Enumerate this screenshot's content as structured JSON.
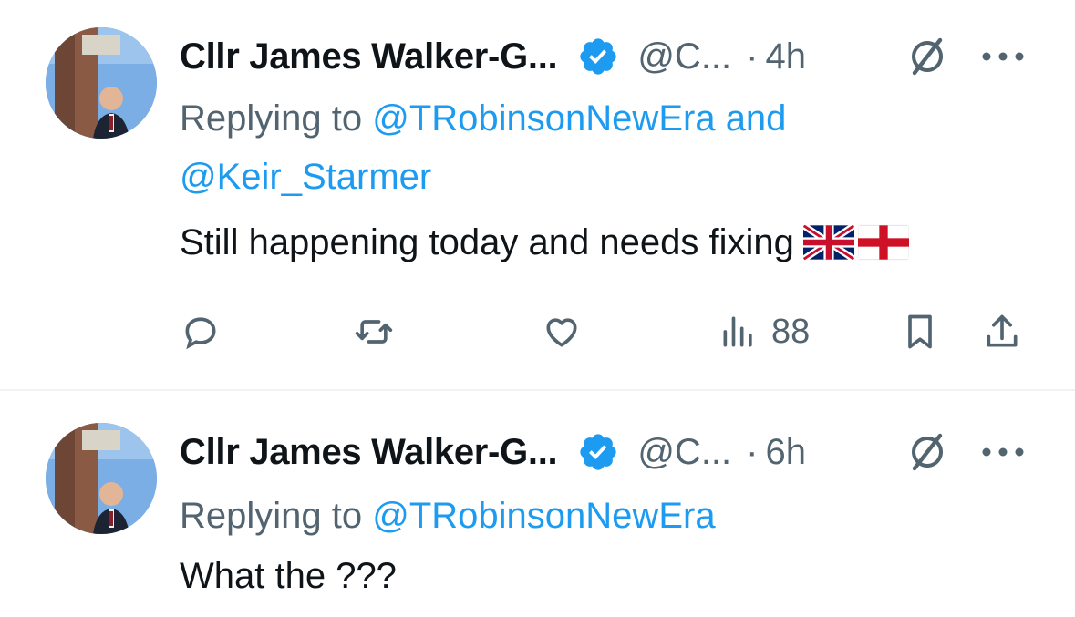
{
  "tweets": [
    {
      "author_name": "Cllr James Walker-G...",
      "handle": "@C...",
      "separator": "·",
      "time": "4h",
      "replying_label": "Replying to",
      "mention_1": "@TRobinsonNewEra",
      "conj": "and",
      "mention_2": "@Keir_Starmer",
      "text": "Still happening today and needs fixing",
      "emojis": [
        "uk-flag-icon",
        "england-flag-icon"
      ],
      "views": "88"
    },
    {
      "author_name": "Cllr James Walker-G...",
      "handle": "@C...",
      "separator": "·",
      "time": "6h",
      "replying_label": "Replying to",
      "mention_1": "@TRobinsonNewEra",
      "text": "What the ???"
    }
  ],
  "colors": {
    "accent": "#1d9bf0",
    "secondary_text": "#536471",
    "primary_text": "#0f1419",
    "divider": "#eff3f4"
  }
}
